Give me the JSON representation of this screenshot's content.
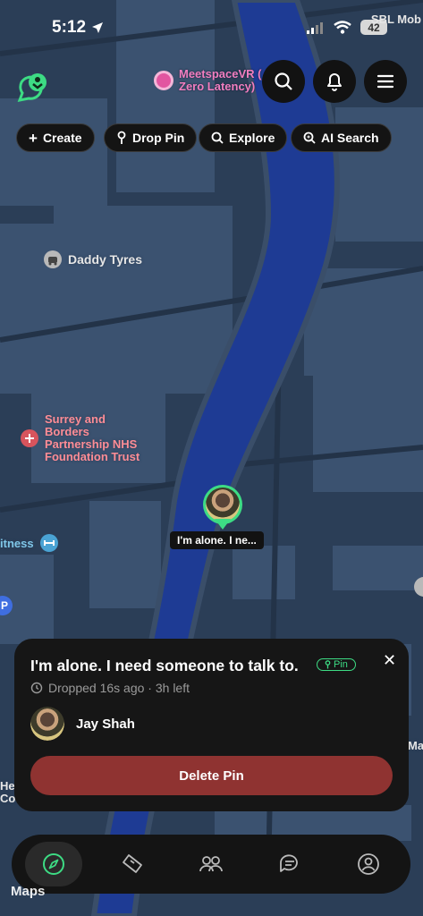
{
  "status_bar": {
    "time": "5:12",
    "battery": "42",
    "corner_label": "SBL Mob"
  },
  "header": {
    "venue_line1": "MeetspaceVR (",
    "venue_line2": "Zero Latency)"
  },
  "chips": [
    {
      "label": "Create",
      "icon": "plus-icon"
    },
    {
      "label": "Drop Pin",
      "icon": "pin-icon"
    },
    {
      "label": "Explore",
      "icon": "search-icon"
    },
    {
      "label": "AI Search",
      "icon": "ai-search-icon"
    }
  ],
  "map": {
    "label_tyres": "Daddy Tyres",
    "poi_line1": "Surrey and",
    "poi_line2": "Borders",
    "poi_line3": "Partnership NHS",
    "poi_line4": "Foundation Trust",
    "label_fitness": "itness",
    "edge_label_1": "Ma",
    "edge_label_2a": "Hea",
    "edge_label_2b": "Cou",
    "pin_caption": "I'm alone.  I ne..."
  },
  "card": {
    "title": "I'm alone.  I need someone to talk to.",
    "badge": "Pin",
    "meta": "Dropped 16s ago · 3h left",
    "user_name": "Jay Shah",
    "delete_label": "Delete Pin"
  },
  "nav": [
    "explore-icon",
    "pins-icon",
    "people-icon",
    "chat-icon",
    "profile-icon"
  ],
  "attribution": "Maps",
  "colors": {
    "accent": "#3ddc84",
    "delete": "#8f3331",
    "map_bg": "#2b3e57",
    "river": "#1e3b94"
  }
}
